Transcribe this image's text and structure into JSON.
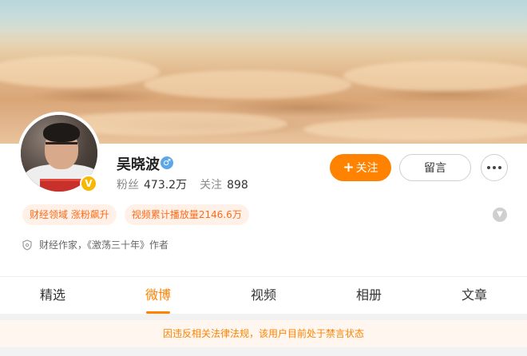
{
  "profile": {
    "name": "吴晓波",
    "gender_icon": "male-icon",
    "verified_badge": "V",
    "fans_label": "粉丝",
    "fans_value": "473.2万",
    "following_label": "关注",
    "following_value": "898"
  },
  "actions": {
    "follow_plus": "+",
    "follow_label": "关注",
    "message_label": "留言",
    "more_icon": "more-icon"
  },
  "tags": [
    "财经领域 涨粉飙升",
    "视频累计播放量2146.6万"
  ],
  "description": "财经作家，《激荡三十年》作者",
  "tabs": [
    "精选",
    "微博",
    "视频",
    "相册",
    "文章"
  ],
  "active_tab": "微博",
  "notice": "因违反相关法律法规，该用户目前处于禁言状态",
  "colors": {
    "accent": "#ff8200",
    "tag_text": "#ff6a1a",
    "tag_bg": "#fff1e8",
    "verified": "#f6b800",
    "gender": "#5ba7e8"
  }
}
